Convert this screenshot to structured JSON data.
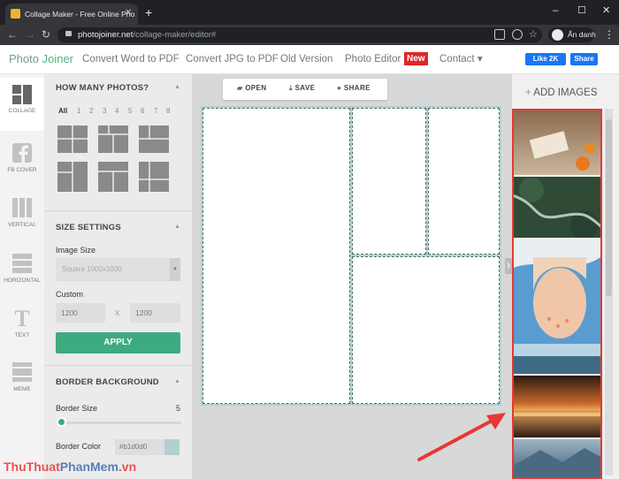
{
  "browser": {
    "tab_title": "Collage Maker - Free Online Pho",
    "url_host": "photojoiner.net",
    "url_path": "/collage-maker/editor#",
    "profile_label": "Ẩn danh"
  },
  "site": {
    "logo_a": "Photo ",
    "logo_b": "Joiner",
    "nav": [
      "Convert Word to PDF",
      "Convert JPG to PDF",
      "Old Version",
      "Photo Editor",
      "Contact ▾"
    ],
    "new_badge": "New",
    "fb_like": "Like 2K",
    "share": "Share"
  },
  "rail": [
    "COLLAGE",
    "FB COVER",
    "VERTICAL",
    "HORIZONTAL",
    "TEXT",
    "MEME"
  ],
  "panel": {
    "how_many": "HOW MANY PHOTOS?",
    "counts": [
      "All",
      "1",
      "2",
      "3",
      "4",
      "5",
      "6",
      "7",
      "8"
    ],
    "size_settings": "SIZE SETTINGS",
    "image_size_label": "Image Size",
    "image_size_value": "Square 1000x1000",
    "custom_label": "Custom",
    "width": "1200",
    "x": "X",
    "height": "1200",
    "apply": "APPLY",
    "border_background": "BORDER BACKGROUND",
    "border_size_label": "Border Size",
    "border_size_value": "5",
    "border_color_label": "Border Color",
    "border_color_value": "#b1d0d0"
  },
  "toolbar": {
    "open": "OPEN",
    "save": "SAVE",
    "share": "SHARE"
  },
  "images": {
    "add": "ADD IMAGES"
  },
  "watermark": {
    "a": "ThuThuat",
    "b": "PhanMem",
    "c": ".vn"
  },
  "colors": {
    "accent": "#3dab7f",
    "canvas_border": "#b1d0d0",
    "highlight": "#e53935"
  }
}
